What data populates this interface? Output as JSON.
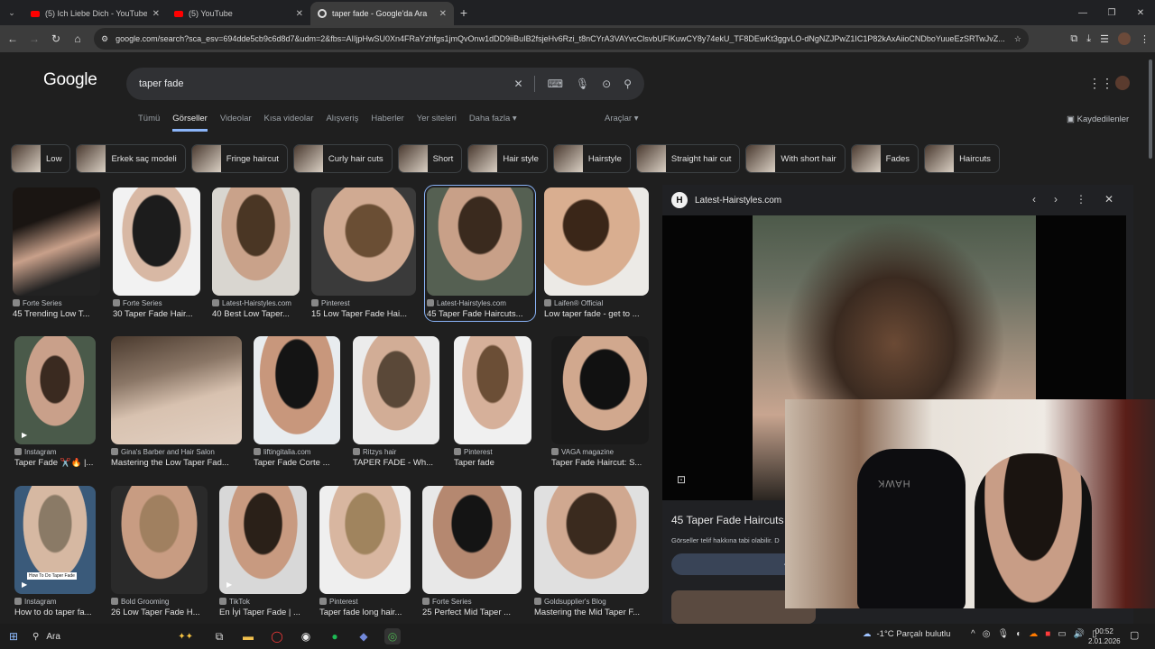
{
  "tabs": [
    {
      "title": "(5) Ich Liebe Dich - YouTube",
      "favicon": "youtube-icon"
    },
    {
      "title": "(5) YouTube",
      "favicon": "youtube-icon"
    },
    {
      "title": "taper fade - Google'da Ara",
      "favicon": "google-icon",
      "active": true
    }
  ],
  "address": "google.com/search?sca_esv=694dde5cb9c6d8d7&udm=2&fbs=AIIjpHwSU0Xn4FRaYzhfgs1jmQvOnw1dDD9iiBuIB2fsjeHv6Rzi_t8nCYrA3VAYvcClsvbUFIKuwCY8y74ekU_TF8DEwKt3ggvLO-dNgNZJPwZ1IC1P82kAxAiioCNDboYuueEzSRTwJvZ...",
  "google": {
    "logo": "Google",
    "query": "taper fade"
  },
  "nav_tabs": [
    "Tümü",
    "Görseller",
    "Videolar",
    "Kısa videolar",
    "Alışveriş",
    "Haberler",
    "Yer siteleri",
    "Daha fazla"
  ],
  "active_tab": "Görseller",
  "tools_label": "Araçlar",
  "saved_label": "Kaydedilenler",
  "chips": [
    "Low",
    "Erkek saç modeli",
    "Fringe haircut",
    "Curly hair cuts",
    "Short",
    "Hair style",
    "Hairstyle",
    "Straight hair cut",
    "With short hair",
    "Fades",
    "Haircuts"
  ],
  "results_row1": [
    {
      "source": "Forte Series",
      "caption": "45 Trending Low T..."
    },
    {
      "source": "Forte Series",
      "caption": "30 Taper Fade Hair..."
    },
    {
      "source": "Latest-Hairstyles.com",
      "caption": "40 Best Low Taper..."
    },
    {
      "source": "Pinterest",
      "caption": "15 Low Taper Fade Hai..."
    },
    {
      "source": "Latest-Hairstyles.com",
      "caption": "45 Taper Fade Haircuts..."
    },
    {
      "source": "Laifen® Official",
      "caption": "Low taper fade - get to ..."
    }
  ],
  "results_row2": [
    {
      "source": "Instagram",
      "caption": "Taper Fade ✂️🔥 |..."
    },
    {
      "source": "Gina's Barber and Hair Salon",
      "caption": "Mastering the Low Taper Fad..."
    },
    {
      "source": "liftingitalia.com",
      "caption": "Taper Fade Corte ..."
    },
    {
      "source": "Ritzys hair",
      "caption": "TAPER FADE - Wh..."
    },
    {
      "source": "Pinterest",
      "caption": "Taper fade"
    },
    {
      "source": "VAGA magazine",
      "caption": "Taper Fade Haircut: S..."
    }
  ],
  "results_row3": [
    {
      "source": "Instagram",
      "caption": "How to do taper fa..."
    },
    {
      "source": "Bold Grooming",
      "caption": "26 Low Taper Fade H..."
    },
    {
      "source": "TikTok",
      "caption": "En İyi Taper Fade | ..."
    },
    {
      "source": "Pinterest",
      "caption": "Taper fade long hair..."
    },
    {
      "source": "Forte Series",
      "caption": "25 Perfect Mid Taper ..."
    },
    {
      "source": "Goldsupplier's Blog",
      "caption": "Mastering the Mid Taper F..."
    }
  ],
  "thumb_overlay_text": "How To Do Taper Fade",
  "preview": {
    "site": "Latest-Hairstyles.com",
    "title": "45 Taper Fade Haircuts",
    "copyright": "Görseller telif hakkına tabi olabilir. D",
    "button": "Pa"
  },
  "webcam_chair_text": "HAWK",
  "taskbar": {
    "search": "Ara",
    "weather": "-1°C  Parçalı bulutlu",
    "time": "00:52",
    "date": "2.01.2026"
  },
  "colors": {
    "accent": "#8ab4f8",
    "background": "#1f1f1f"
  }
}
